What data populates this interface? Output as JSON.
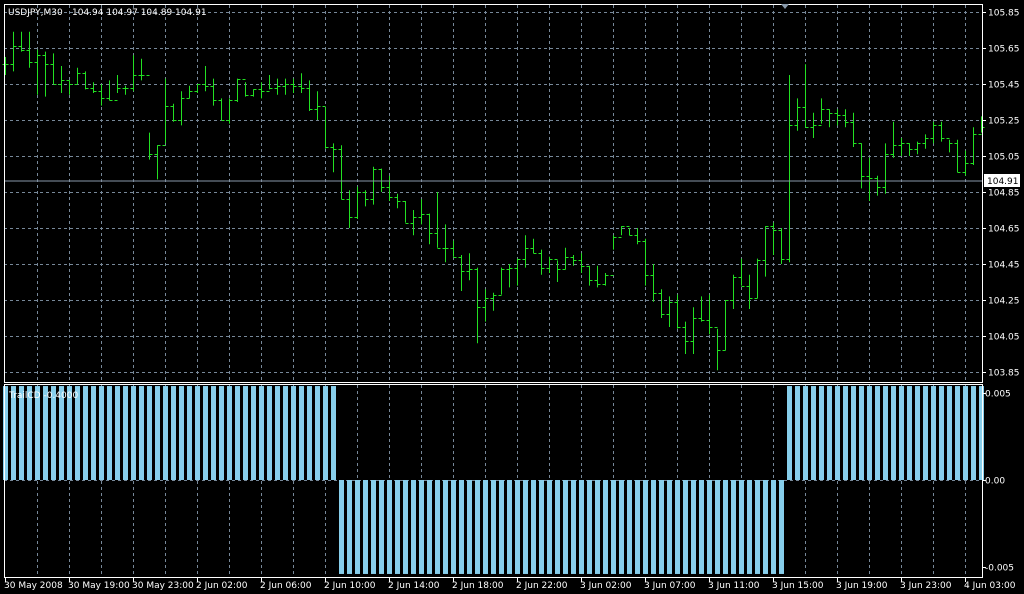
{
  "header": {
    "symbol_timeframe": "USDJPY,M30",
    "ohlc_readout": "104.94 104.97 104.89 104.91"
  },
  "current_price": "104.91",
  "indicator": {
    "label": "TrailCD -0.4000"
  },
  "colors": {
    "background": "#000000",
    "bar": "#22e022",
    "grid": "#778899",
    "histogram": "#87ceeb",
    "axis": "#ffffff"
  },
  "chart_data": [
    {
      "type": "ohlc",
      "title": "USDJPY,M30",
      "ylim": [
        103.85,
        105.85
      ],
      "y_ticks": [
        "105.85",
        "105.65",
        "105.45",
        "105.25",
        "105.05",
        "104.85",
        "104.65",
        "104.45",
        "104.25",
        "104.05",
        "103.85"
      ],
      "x_tick_labels": [
        "30 May 2008",
        "30 May 19:00",
        "30 May 23:00",
        "2 Jun 02:00",
        "2 Jun 06:00",
        "2 Jun 10:00",
        "2 Jun 14:00",
        "2 Jun 18:00",
        "2 Jun 22:00",
        "3 Jun 02:00",
        "3 Jun 07:00",
        "3 Jun 11:00",
        "3 Jun 15:00",
        "3 Jun 19:00",
        "3 Jun 23:00",
        "4 Jun 03:00"
      ],
      "bars_hlc": [
        [
          105.6,
          105.5,
          105.56
        ],
        [
          105.74,
          105.52,
          105.66
        ],
        [
          105.74,
          105.63,
          105.64
        ],
        [
          105.74,
          105.54,
          105.57
        ],
        [
          105.64,
          105.39,
          105.61
        ],
        [
          105.63,
          105.38,
          105.56
        ],
        [
          105.62,
          105.45,
          105.45
        ],
        [
          105.55,
          105.4,
          105.47
        ],
        [
          105.47,
          105.39,
          105.45
        ],
        [
          105.54,
          105.45,
          105.51
        ],
        [
          105.52,
          105.42,
          105.43
        ],
        [
          105.46,
          105.4,
          105.41
        ],
        [
          105.45,
          105.33,
          105.37
        ],
        [
          105.47,
          105.36,
          105.36
        ],
        [
          105.5,
          105.4,
          105.43
        ],
        [
          105.44,
          105.39,
          105.43
        ],
        [
          105.61,
          105.41,
          105.5
        ],
        [
          105.59,
          105.47,
          105.5
        ],
        [
          105.18,
          105.03,
          105.06
        ],
        [
          105.11,
          104.92,
          105.11
        ],
        [
          105.48,
          105.12,
          105.33
        ],
        [
          105.34,
          105.24,
          105.25
        ],
        [
          105.41,
          105.22,
          105.37
        ],
        [
          105.44,
          105.37,
          105.41
        ],
        [
          105.45,
          105.4,
          105.45
        ],
        [
          105.55,
          105.41,
          105.44
        ],
        [
          105.48,
          105.33,
          105.36
        ],
        [
          105.37,
          105.25,
          105.25
        ],
        [
          105.37,
          105.23,
          105.36
        ],
        [
          105.48,
          105.35,
          105.48
        ],
        [
          105.46,
          105.38,
          105.39
        ],
        [
          105.42,
          105.38,
          105.42
        ],
        [
          105.46,
          105.37,
          105.41
        ],
        [
          105.5,
          105.42,
          105.43
        ],
        [
          105.48,
          105.39,
          105.44
        ],
        [
          105.48,
          105.39,
          105.45
        ],
        [
          105.48,
          105.4,
          105.44
        ],
        [
          105.51,
          105.4,
          105.43
        ],
        [
          105.47,
          105.3,
          105.31
        ],
        [
          105.41,
          105.25,
          105.33
        ],
        [
          105.32,
          105.09,
          105.1
        ],
        [
          105.12,
          104.96,
          105.09
        ],
        [
          105.11,
          104.81,
          104.81
        ],
        [
          104.86,
          104.65,
          104.71
        ],
        [
          104.88,
          104.7,
          104.85
        ],
        [
          104.86,
          104.77,
          104.81
        ],
        [
          104.99,
          104.78,
          104.98
        ],
        [
          104.98,
          104.85,
          104.88
        ],
        [
          104.94,
          104.8,
          104.82
        ],
        [
          104.84,
          104.76,
          104.8
        ],
        [
          104.8,
          104.68,
          104.68
        ],
        [
          104.75,
          104.61,
          104.71
        ],
        [
          104.81,
          104.67,
          104.73
        ],
        [
          104.73,
          104.56,
          104.62
        ],
        [
          104.85,
          104.54,
          104.54
        ],
        [
          104.67,
          104.46,
          104.54
        ],
        [
          104.58,
          104.49,
          104.49
        ],
        [
          104.5,
          104.3,
          104.41
        ],
        [
          104.51,
          104.36,
          104.42
        ],
        [
          104.43,
          104.01,
          104.21
        ],
        [
          104.31,
          104.13,
          104.26
        ],
        [
          104.29,
          104.19,
          104.28
        ],
        [
          104.43,
          104.28,
          104.42
        ],
        [
          104.45,
          104.32,
          104.43
        ],
        [
          104.48,
          104.33,
          104.48
        ],
        [
          104.61,
          104.43,
          104.54
        ],
        [
          104.59,
          104.51,
          104.51
        ],
        [
          104.53,
          104.39,
          104.43
        ],
        [
          104.49,
          104.4,
          104.48
        ],
        [
          104.47,
          104.35,
          104.42
        ],
        [
          104.54,
          104.42,
          104.49
        ],
        [
          104.5,
          104.44,
          104.47
        ],
        [
          104.51,
          104.4,
          104.44
        ],
        [
          104.44,
          104.33,
          104.36
        ],
        [
          104.44,
          104.32,
          104.34
        ],
        [
          104.4,
          104.33,
          104.39
        ],
        [
          104.61,
          104.53,
          104.6
        ],
        [
          104.66,
          104.61,
          104.66
        ],
        [
          104.65,
          104.61,
          104.61
        ],
        [
          104.65,
          104.56,
          104.58
        ],
        [
          104.59,
          104.33,
          104.39
        ],
        [
          104.45,
          104.24,
          104.29
        ],
        [
          104.31,
          104.15,
          104.17
        ],
        [
          104.27,
          104.1,
          104.24
        ],
        [
          104.28,
          104.09,
          104.1
        ],
        [
          104.13,
          103.95,
          104.02
        ],
        [
          104.21,
          103.95,
          104.15
        ],
        [
          104.27,
          104.13,
          104.14
        ],
        [
          104.28,
          104.06,
          104.1
        ],
        [
          104.09,
          103.86,
          103.97
        ],
        [
          104.25,
          103.97,
          104.25
        ],
        [
          104.39,
          104.2,
          104.38
        ],
        [
          104.48,
          104.33,
          104.33
        ],
        [
          104.39,
          104.2,
          104.26
        ],
        [
          104.48,
          104.26,
          104.47
        ],
        [
          104.66,
          104.38,
          104.66
        ],
        [
          104.68,
          104.5,
          104.64
        ],
        [
          104.65,
          104.45,
          104.48
        ],
        [
          105.5,
          104.46,
          105.22
        ],
        [
          105.37,
          105.19,
          105.32
        ],
        [
          105.56,
          105.21,
          105.21
        ],
        [
          105.29,
          105.15,
          105.22
        ],
        [
          105.37,
          105.23,
          105.31
        ],
        [
          105.31,
          105.21,
          105.29
        ],
        [
          105.31,
          105.22,
          105.28
        ],
        [
          105.31,
          105.21,
          105.24
        ],
        [
          105.29,
          105.1,
          105.12
        ],
        [
          105.12,
          104.87,
          104.94
        ],
        [
          105.04,
          104.8,
          104.93
        ],
        [
          104.94,
          104.83,
          104.88
        ],
        [
          105.12,
          104.84,
          105.06
        ],
        [
          105.24,
          105.04,
          105.11
        ],
        [
          105.15,
          105.05,
          105.12
        ],
        [
          105.12,
          105.05,
          105.09
        ],
        [
          105.13,
          105.06,
          105.12
        ],
        [
          105.17,
          105.09,
          105.15
        ],
        [
          105.24,
          105.12,
          105.22
        ],
        [
          105.24,
          105.13,
          105.15
        ],
        [
          105.14,
          105.07,
          105.12
        ],
        [
          105.14,
          104.96,
          104.96
        ],
        [
          105.08,
          104.94,
          105.01
        ],
        [
          105.21,
          105.0,
          105.17
        ],
        [
          105.27,
          105.18,
          105.21
        ]
      ]
    },
    {
      "type": "bar",
      "title": "TrailCD -0.4000",
      "ylim": [
        -0.0055,
        0.0055
      ],
      "y_ticks": [
        "0.005",
        "0.00",
        "-0.005"
      ],
      "tick_values": [
        0.005,
        0,
        -0.005
      ],
      "magnitude": 0.0054,
      "segments": [
        {
          "from": 0,
          "to": 41,
          "sign": 1
        },
        {
          "from": 42,
          "to": 97,
          "sign": -1
        },
        {
          "from": 98,
          "to": 122,
          "sign": 1
        }
      ]
    }
  ]
}
